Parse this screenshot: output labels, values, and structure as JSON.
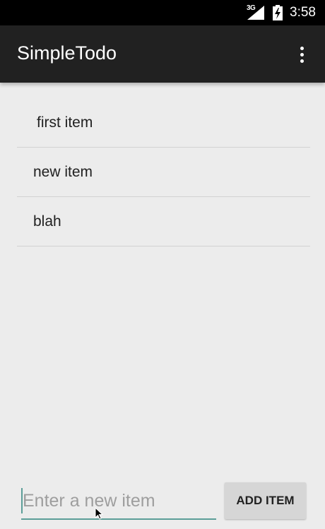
{
  "status_bar": {
    "network": "3G",
    "time": "3:58",
    "icons": [
      "signal-icon",
      "battery-charging-icon"
    ]
  },
  "action_bar": {
    "title": "SimpleTodo",
    "overflow_icon": "overflow-menu-icon"
  },
  "todo_list": {
    "items": [
      {
        "label": "first item"
      },
      {
        "label": "new item"
      },
      {
        "label": "blah"
      }
    ]
  },
  "new_item": {
    "placeholder": "Enter a new item",
    "value": ""
  },
  "add_button": {
    "label": "ADD ITEM"
  },
  "colors": {
    "action_bar": "#212121",
    "background": "#ececec",
    "accent": "#5c9e98",
    "button": "#d6d6d6"
  }
}
